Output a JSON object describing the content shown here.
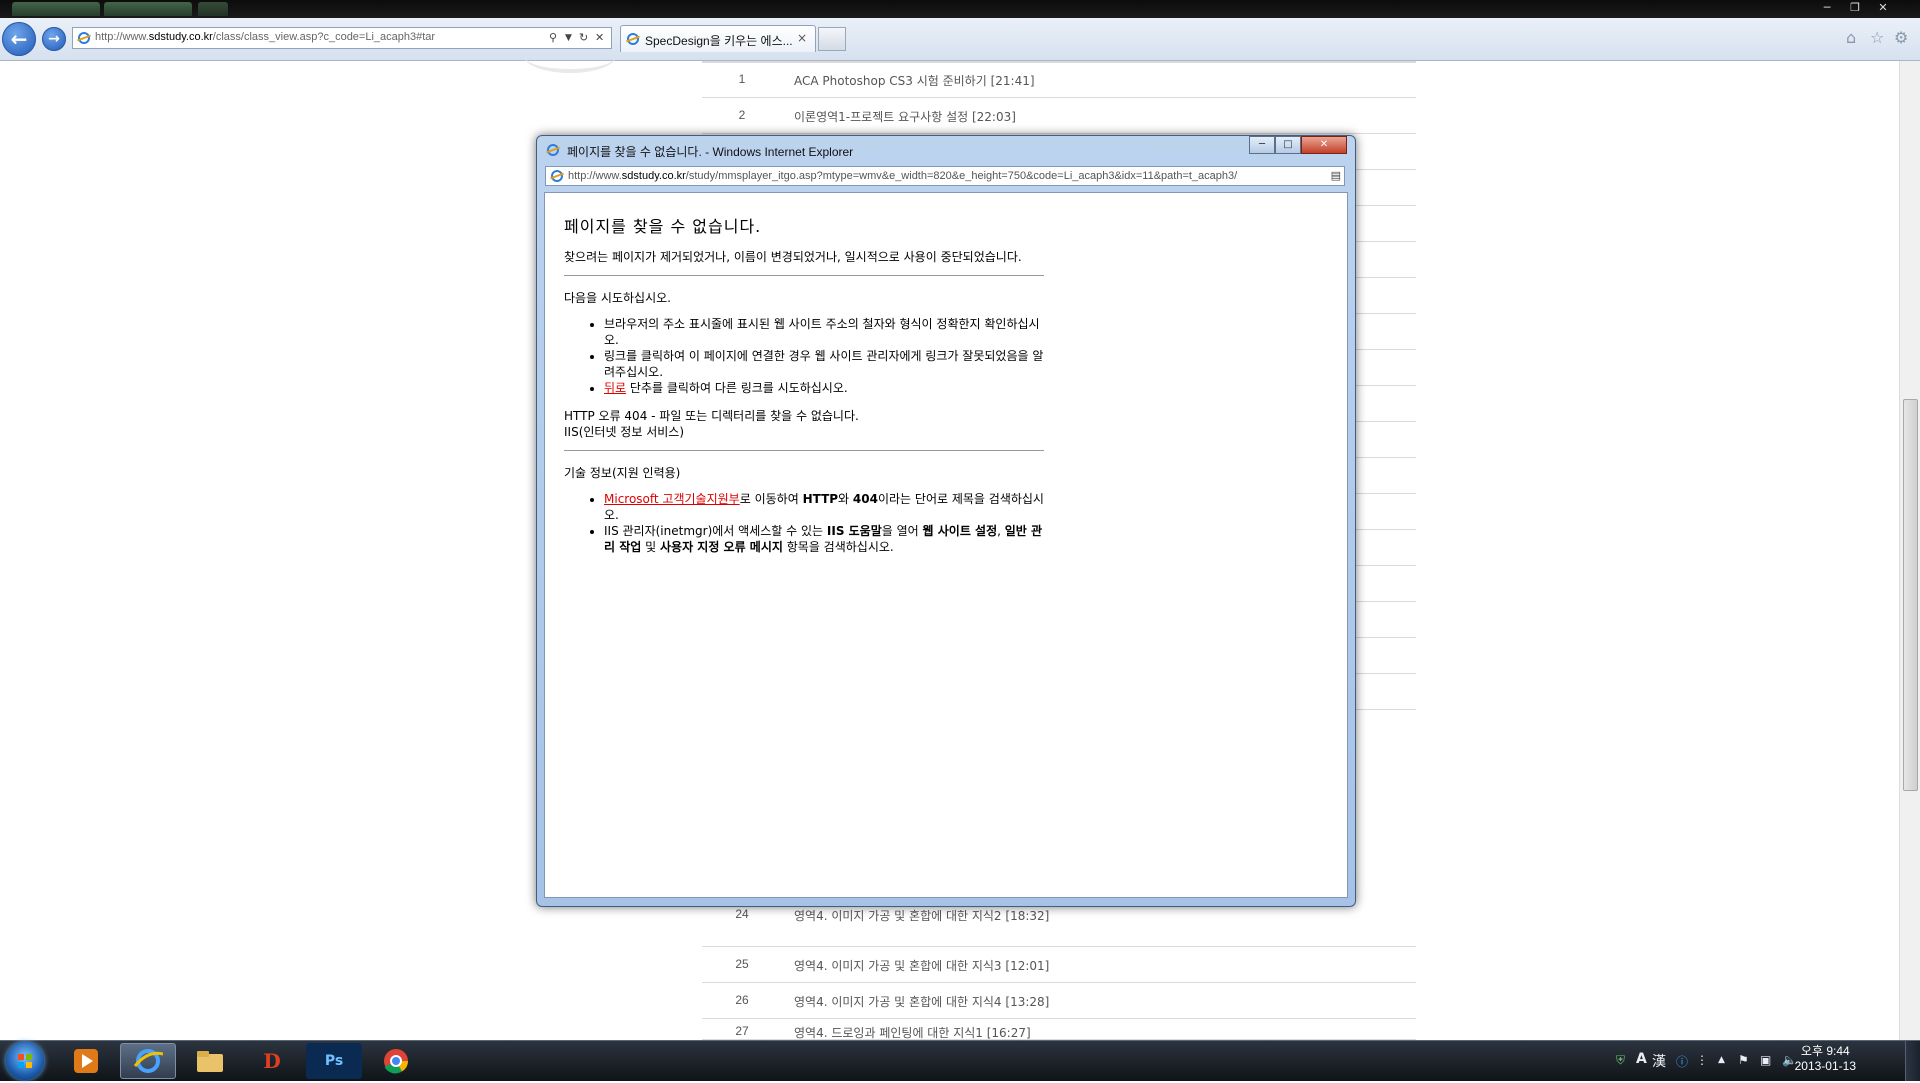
{
  "browser": {
    "address_url_prefix": "http://www.",
    "address_url_domain": "sdstudy.co.kr",
    "address_url_path": "/class/class_view.asp?c_code=Li_acaph3#tar",
    "tab_title": "SpecDesign을 키우는 에스...",
    "tab_close": "×",
    "new_tab": ""
  },
  "lessons": [
    {
      "num": "1",
      "title": "ACA Photoshop CS3 시험 준비하기  [21:41]"
    },
    {
      "num": "2",
      "title": "이론영역1-프로젝트 요구사항 설정  [22:03]"
    },
    {
      "num": "24",
      "title": "영역4. 이미지 가공 및 혼합에 대한 지식2  [18:32]"
    },
    {
      "num": "25",
      "title": "영역4. 이미지 가공 및 혼합에 대한 지식3  [12:01]"
    },
    {
      "num": "26",
      "title": "영역4. 이미지 가공 및 혼합에 대한 지식4  [13:28]"
    },
    {
      "num": "27",
      "title": "영역4. 드로잉과 페인팅에 대한 지식1  [16:27]"
    }
  ],
  "popup": {
    "title": "페이지를 찾을 수 없습니다. - Windows Internet Explorer",
    "url_prefix": "http://www.",
    "url_domain": "sdstudy.co.kr",
    "url_path": "/study/mmsplayer_itgo.asp?mtype=wmv&e_width=820&e_height=750&code=Li_acaph3&idx=11&path=t_acaph3/",
    "error": {
      "heading": "페이지를 찾을 수 없습니다.",
      "description": "찾으려는 페이지가 제거되었거나, 이름이 변경되었거나, 일시적으로 사용이 중단되었습니다.",
      "try_heading": "다음을 시도하십시오.",
      "try_item1": "브라우저의 주소 표시줄에 표시된 웹 사이트 주소의 철자와 형식이 정확한지 확인하십시오.",
      "try_item2": "링크를 클릭하여 이 페이지에 연결한 경우 웹 사이트 관리자에게 링크가 잘못되었음을 알려주십시오.",
      "try_item3_link": "뒤로",
      "try_item3_text": " 단추를 클릭하여 다른 링크를 시도하십시오.",
      "http_error": "HTTP 오류 404 - 파일 또는 디렉터리를 찾을 수 없습니다.",
      "iis": "IIS(인터넷 정보 서비스)",
      "tech_heading": "기술 정보(지원 인력용)",
      "tech_item1_link": "Microsoft 고객기술지원부",
      "tech_item1_a": "로 이동하여 ",
      "tech_item1_http": "HTTP",
      "tech_item1_b": "와 ",
      "tech_item1_404": "404",
      "tech_item1_c": "이라는 단어로 제목을 검색하십시오.",
      "tech_item2_a": "IIS 관리자(inetmgr)에서 액세스할 수 있는 ",
      "tech_item2_help": "IIS 도움말",
      "tech_item2_b": "을 열어 ",
      "tech_item2_site": "웹 사이트 설정",
      "tech_item2_c": ", ",
      "tech_item2_admin": "일반 관리 작업",
      "tech_item2_d": " 및 ",
      "tech_item2_custom": "사용자 지정 오류 메시지",
      "tech_item2_e": " 항목을 검색하십시오."
    }
  },
  "taskbar": {
    "photoshop_label": "Ps",
    "diablo_label": "D",
    "ime_a": "A",
    "ime_han": "漢",
    "time": "오후 9:44",
    "date": "2013-01-13"
  },
  "colors": {
    "link_red": "#e00000",
    "ie_blue": "#2b7de1",
    "photoshop_bg": "#0b2a52",
    "photoshop_fg": "#6ec0ff"
  }
}
